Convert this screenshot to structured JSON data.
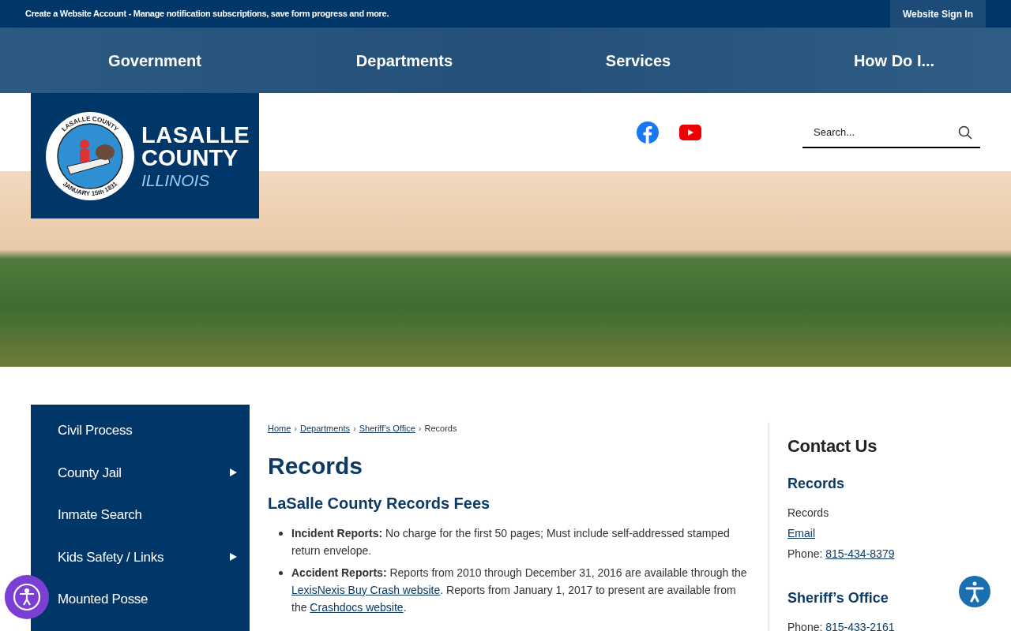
{
  "top_bar": {
    "message": "Create a Website Account - Manage notification subscriptions, save form progress and more.",
    "sign_in": "Website Sign In"
  },
  "nav": [
    "Government",
    "Departments",
    "Services",
    "How Do I..."
  ],
  "logo": {
    "seal_top": "LASALLE COUNTY",
    "seal_bottom": "JANUARY 15th 1831",
    "line1": "LASALLE",
    "line2": "COUNTY",
    "line3": "ILLINOIS"
  },
  "social": [
    {
      "kind": "facebook"
    },
    {
      "kind": "youtube"
    }
  ],
  "search": {
    "placeholder": "Search..."
  },
  "sidebar": [
    {
      "label": "Civil Process",
      "has_submenu": false
    },
    {
      "label": "County Jail",
      "has_submenu": true
    },
    {
      "label": "Inmate Search",
      "has_submenu": false
    },
    {
      "label": "Kids Safety / Links",
      "has_submenu": true
    },
    {
      "label": "Mounted Posse",
      "has_submenu": false
    }
  ],
  "breadcrumb": [
    {
      "label": "Home",
      "link": true
    },
    {
      "separator": "›",
      "label": "Departments",
      "link": true
    },
    {
      "separator": "›",
      "label": "Sheriff’s Office",
      "link": true
    },
    {
      "separator": "›",
      "label": "Records",
      "link": false
    }
  ],
  "title": "Records",
  "subtitle": "LaSalle County Records Fees",
  "items": [
    {
      "term": "Incident Reports:",
      "parts": [
        {
          "text": " No charge for the first 50 pages; Must include self-addressed stamped return envelope.",
          "link": false
        }
      ]
    },
    {
      "term": "Accident Reports:",
      "parts": [
        {
          "text": " Reports from 2010 through December 31, 2016 are available through the ",
          "link": false
        },
        {
          "text": "LexisNexis Buy Crash website",
          "link": true
        },
        {
          "text": ". Reports from January 1, 2017 to present are available from the ",
          "link": false
        },
        {
          "text": "Crashdocs website",
          "link": true
        },
        {
          "text": ".",
          "link": false
        }
      ]
    }
  ],
  "contact": {
    "title": "Contact Us",
    "groups": [
      {
        "heading": "Records",
        "lines": [
          {
            "label": "Records",
            "kind": "text"
          },
          {
            "label": "Email",
            "kind": "link"
          },
          {
            "label": "Phone: ",
            "value": "815-434-8379",
            "kind": "phone"
          }
        ]
      },
      {
        "heading": "Sheriff’s Office",
        "lines": [
          {
            "label": "Phone: ",
            "value": "815-433-2161",
            "kind": "phone"
          }
        ]
      }
    ]
  }
}
